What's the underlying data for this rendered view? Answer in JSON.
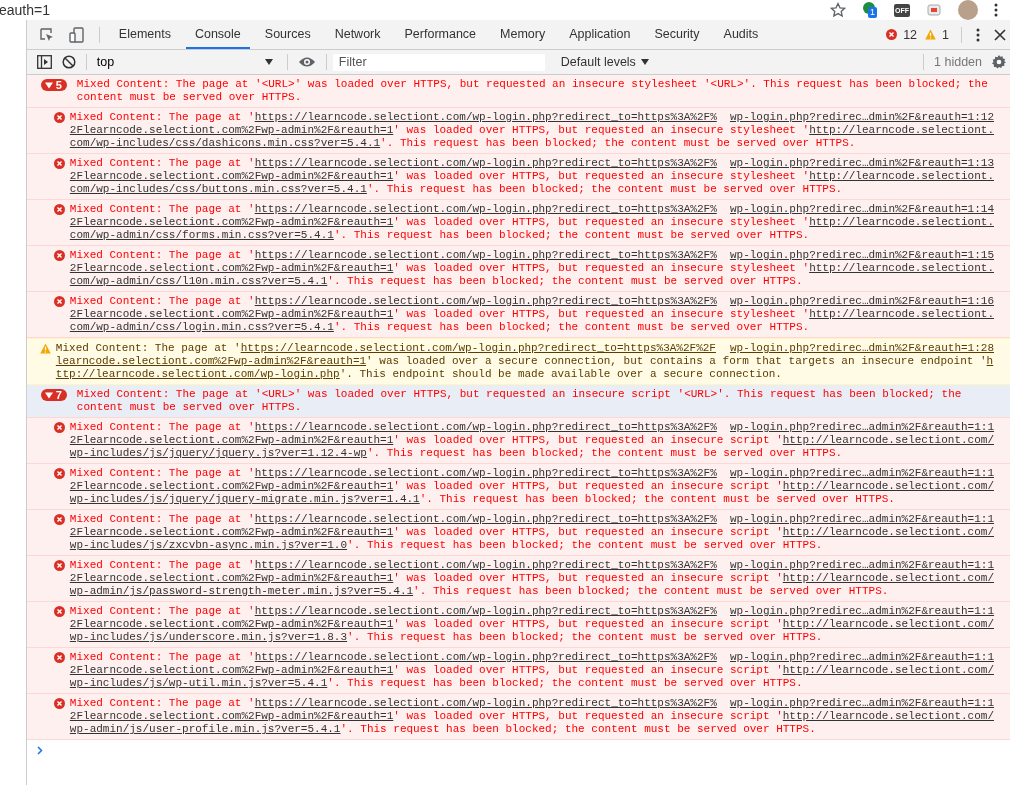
{
  "browser": {
    "address_fragment": "eauth=1",
    "extension_badge": "1",
    "extension_label": "OFF"
  },
  "devtools": {
    "tabs": [
      {
        "label": "Elements",
        "selected": false
      },
      {
        "label": "Console",
        "selected": true
      },
      {
        "label": "Sources",
        "selected": false
      },
      {
        "label": "Network",
        "selected": false
      },
      {
        "label": "Performance",
        "selected": false
      },
      {
        "label": "Memory",
        "selected": false
      },
      {
        "label": "Application",
        "selected": false
      },
      {
        "label": "Security",
        "selected": false
      },
      {
        "label": "Audits",
        "selected": false
      }
    ],
    "error_count": "12",
    "warning_count": "1"
  },
  "console_toolbar": {
    "context": "top",
    "filter_placeholder": "Filter",
    "levels": "Default levels",
    "hidden": "1 hidden"
  },
  "messages": [
    {
      "kind": "group",
      "count": "5",
      "expanded": true,
      "selected": false,
      "lines": [
        [
          {
            "text": "Mixed Content: The page at '<URL>' was loaded over HTTPS, but requested an insecure stylesheet '<URL>'. This request has been blocked; the",
            "link": false
          }
        ],
        [
          {
            "text": "content must be served over HTTPS.",
            "link": false
          }
        ]
      ]
    },
    {
      "kind": "error",
      "source": "wp-login.php?redirec…dmin%2F&reauth=1:12",
      "lines": [
        [
          {
            "text": "Mixed Content: The page at '",
            "link": false
          },
          {
            "text": "https://learncode.selectiont.com/wp-login.php?redirect_to=https%3A%2F%",
            "link": true
          }
        ],
        [
          {
            "text": "2Flearncode.selectiont.com%2Fwp-admin%2F&reauth=1",
            "link": true
          },
          {
            "text": "' was loaded over HTTPS, but requested an insecure stylesheet '",
            "link": false
          },
          {
            "text": "http://learncode.selectiont.",
            "link": true
          }
        ],
        [
          {
            "text": "com/wp-includes/css/dashicons.min.css?ver=5.4.1",
            "link": true
          },
          {
            "text": "'. This request has been blocked; the content must be served over HTTPS.",
            "link": false
          }
        ]
      ]
    },
    {
      "kind": "error",
      "source": "wp-login.php?redirec…dmin%2F&reauth=1:13",
      "lines": [
        [
          {
            "text": "Mixed Content: The page at '",
            "link": false
          },
          {
            "text": "https://learncode.selectiont.com/wp-login.php?redirect_to=https%3A%2F%",
            "link": true
          }
        ],
        [
          {
            "text": "2Flearncode.selectiont.com%2Fwp-admin%2F&reauth=1",
            "link": true
          },
          {
            "text": "' was loaded over HTTPS, but requested an insecure stylesheet '",
            "link": false
          },
          {
            "text": "http://learncode.selectiont.",
            "link": true
          }
        ],
        [
          {
            "text": "com/wp-includes/css/buttons.min.css?ver=5.4.1",
            "link": true
          },
          {
            "text": "'. This request has been blocked; the content must be served over HTTPS.",
            "link": false
          }
        ]
      ]
    },
    {
      "kind": "error",
      "source": "wp-login.php?redirec…dmin%2F&reauth=1:14",
      "lines": [
        [
          {
            "text": "Mixed Content: The page at '",
            "link": false
          },
          {
            "text": "https://learncode.selectiont.com/wp-login.php?redirect_to=https%3A%2F%",
            "link": true
          }
        ],
        [
          {
            "text": "2Flearncode.selectiont.com%2Fwp-admin%2F&reauth=1",
            "link": true
          },
          {
            "text": "' was loaded over HTTPS, but requested an insecure stylesheet '",
            "link": false
          },
          {
            "text": "http://learncode.selectiont.",
            "link": true
          }
        ],
        [
          {
            "text": "com/wp-admin/css/forms.min.css?ver=5.4.1",
            "link": true
          },
          {
            "text": "'. This request has been blocked; the content must be served over HTTPS.",
            "link": false
          }
        ]
      ]
    },
    {
      "kind": "error",
      "source": "wp-login.php?redirec…dmin%2F&reauth=1:15",
      "lines": [
        [
          {
            "text": "Mixed Content: The page at '",
            "link": false
          },
          {
            "text": "https://learncode.selectiont.com/wp-login.php?redirect_to=https%3A%2F%",
            "link": true
          }
        ],
        [
          {
            "text": "2Flearncode.selectiont.com%2Fwp-admin%2F&reauth=1",
            "link": true
          },
          {
            "text": "' was loaded over HTTPS, but requested an insecure stylesheet '",
            "link": false
          },
          {
            "text": "http://learncode.selectiont.",
            "link": true
          }
        ],
        [
          {
            "text": "com/wp-admin/css/l10n.min.css?ver=5.4.1",
            "link": true
          },
          {
            "text": "'. This request has been blocked; the content must be served over HTTPS.",
            "link": false
          }
        ]
      ]
    },
    {
      "kind": "error",
      "source": "wp-login.php?redirec…dmin%2F&reauth=1:16",
      "lines": [
        [
          {
            "text": "Mixed Content: The page at '",
            "link": false
          },
          {
            "text": "https://learncode.selectiont.com/wp-login.php?redirect_to=https%3A%2F%",
            "link": true
          }
        ],
        [
          {
            "text": "2Flearncode.selectiont.com%2Fwp-admin%2F&reauth=1",
            "link": true
          },
          {
            "text": "' was loaded over HTTPS, but requested an insecure stylesheet '",
            "link": false
          },
          {
            "text": "http://learncode.selectiont.",
            "link": true
          }
        ],
        [
          {
            "text": "com/wp-admin/css/login.min.css?ver=5.4.1",
            "link": true
          },
          {
            "text": "'. This request has been blocked; the content must be served over HTTPS.",
            "link": false
          }
        ]
      ]
    },
    {
      "kind": "warning",
      "source": "wp-login.php?redirec…dmin%2F&reauth=1:28",
      "lines": [
        [
          {
            "text": "Mixed Content: The page at '",
            "link": false
          },
          {
            "text": "https://learncode.selectiont.com/wp-login.php?redirect_to=https%3A%2F%2F",
            "link": true
          }
        ],
        [
          {
            "text": "learncode.selectiont.com%2Fwp-admin%2F&reauth=1",
            "link": true
          },
          {
            "text": "' was loaded over a secure connection, but contains a form that targets an insecure endpoint '",
            "link": false
          },
          {
            "text": "h",
            "link": true
          }
        ],
        [
          {
            "text": "ttp://learncode.selectiont.com/wp-login.php",
            "link": true
          },
          {
            "text": "'. This endpoint should be made available over a secure connection.",
            "link": false
          }
        ]
      ]
    },
    {
      "kind": "group",
      "count": "7",
      "expanded": true,
      "selected": true,
      "lines": [
        [
          {
            "text": "Mixed Content: The page at '<URL>' was loaded over HTTPS, but requested an insecure script '<URL>'. This request has been blocked; the",
            "link": false
          }
        ],
        [
          {
            "text": "content must be served over HTTPS.",
            "link": false
          }
        ]
      ]
    },
    {
      "kind": "error",
      "source": "wp-login.php?redirec…admin%2F&reauth=1:1",
      "lines": [
        [
          {
            "text": "Mixed Content: The page at '",
            "link": false
          },
          {
            "text": "https://learncode.selectiont.com/wp-login.php?redirect_to=https%3A%2F%",
            "link": true
          }
        ],
        [
          {
            "text": "2Flearncode.selectiont.com%2Fwp-admin%2F&reauth=1",
            "link": true
          },
          {
            "text": "' was loaded over HTTPS, but requested an insecure script '",
            "link": false
          },
          {
            "text": "http://learncode.selectiont.com/",
            "link": true
          }
        ],
        [
          {
            "text": "wp-includes/js/jquery/jquery.js?ver=1.12.4-wp",
            "link": true
          },
          {
            "text": "'. This request has been blocked; the content must be served over HTTPS.",
            "link": false
          }
        ]
      ]
    },
    {
      "kind": "error",
      "source": "wp-login.php?redirec…admin%2F&reauth=1:1",
      "lines": [
        [
          {
            "text": "Mixed Content: The page at '",
            "link": false
          },
          {
            "text": "https://learncode.selectiont.com/wp-login.php?redirect_to=https%3A%2F%",
            "link": true
          }
        ],
        [
          {
            "text": "2Flearncode.selectiont.com%2Fwp-admin%2F&reauth=1",
            "link": true
          },
          {
            "text": "' was loaded over HTTPS, but requested an insecure script '",
            "link": false
          },
          {
            "text": "http://learncode.selectiont.com/",
            "link": true
          }
        ],
        [
          {
            "text": "wp-includes/js/jquery/jquery-migrate.min.js?ver=1.4.1",
            "link": true
          },
          {
            "text": "'. This request has been blocked; the content must be served over HTTPS.",
            "link": false
          }
        ]
      ]
    },
    {
      "kind": "error",
      "source": "wp-login.php?redirec…admin%2F&reauth=1:1",
      "lines": [
        [
          {
            "text": "Mixed Content: The page at '",
            "link": false
          },
          {
            "text": "https://learncode.selectiont.com/wp-login.php?redirect_to=https%3A%2F%",
            "link": true
          }
        ],
        [
          {
            "text": "2Flearncode.selectiont.com%2Fwp-admin%2F&reauth=1",
            "link": true
          },
          {
            "text": "' was loaded over HTTPS, but requested an insecure script '",
            "link": false
          },
          {
            "text": "http://learncode.selectiont.com/",
            "link": true
          }
        ],
        [
          {
            "text": "wp-includes/js/zxcvbn-async.min.js?ver=1.0",
            "link": true
          },
          {
            "text": "'. This request has been blocked; the content must be served over HTTPS.",
            "link": false
          }
        ]
      ]
    },
    {
      "kind": "error",
      "source": "wp-login.php?redirec…admin%2F&reauth=1:1",
      "lines": [
        [
          {
            "text": "Mixed Content: The page at '",
            "link": false
          },
          {
            "text": "https://learncode.selectiont.com/wp-login.php?redirect_to=https%3A%2F%",
            "link": true
          }
        ],
        [
          {
            "text": "2Flearncode.selectiont.com%2Fwp-admin%2F&reauth=1",
            "link": true
          },
          {
            "text": "' was loaded over HTTPS, but requested an insecure script '",
            "link": false
          },
          {
            "text": "http://learncode.selectiont.com/",
            "link": true
          }
        ],
        [
          {
            "text": "wp-admin/js/password-strength-meter.min.js?ver=5.4.1",
            "link": true
          },
          {
            "text": "'. This request has been blocked; the content must be served over HTTPS.",
            "link": false
          }
        ]
      ]
    },
    {
      "kind": "error",
      "source": "wp-login.php?redirec…admin%2F&reauth=1:1",
      "lines": [
        [
          {
            "text": "Mixed Content: The page at '",
            "link": false
          },
          {
            "text": "https://learncode.selectiont.com/wp-login.php?redirect_to=https%3A%2F%",
            "link": true
          }
        ],
        [
          {
            "text": "2Flearncode.selectiont.com%2Fwp-admin%2F&reauth=1",
            "link": true
          },
          {
            "text": "' was loaded over HTTPS, but requested an insecure script '",
            "link": false
          },
          {
            "text": "http://learncode.selectiont.com/",
            "link": true
          }
        ],
        [
          {
            "text": "wp-includes/js/underscore.min.js?ver=1.8.3",
            "link": true
          },
          {
            "text": "'. This request has been blocked; the content must be served over HTTPS.",
            "link": false
          }
        ]
      ]
    },
    {
      "kind": "error",
      "source": "wp-login.php?redirec…admin%2F&reauth=1:1",
      "lines": [
        [
          {
            "text": "Mixed Content: The page at '",
            "link": false
          },
          {
            "text": "https://learncode.selectiont.com/wp-login.php?redirect_to=https%3A%2F%",
            "link": true
          }
        ],
        [
          {
            "text": "2Flearncode.selectiont.com%2Fwp-admin%2F&reauth=1",
            "link": true
          },
          {
            "text": "' was loaded over HTTPS, but requested an insecure script '",
            "link": false
          },
          {
            "text": "http://learncode.selectiont.com/",
            "link": true
          }
        ],
        [
          {
            "text": "wp-includes/js/wp-util.min.js?ver=5.4.1",
            "link": true
          },
          {
            "text": "'. This request has been blocked; the content must be served over HTTPS.",
            "link": false
          }
        ]
      ]
    },
    {
      "kind": "error",
      "source": "wp-login.php?redirec…admin%2F&reauth=1:1",
      "lines": [
        [
          {
            "text": "Mixed Content: The page at '",
            "link": false
          },
          {
            "text": "https://learncode.selectiont.com/wp-login.php?redirect_to=https%3A%2F%",
            "link": true
          }
        ],
        [
          {
            "text": "2Flearncode.selectiont.com%2Fwp-admin%2F&reauth=1",
            "link": true
          },
          {
            "text": "' was loaded over HTTPS, but requested an insecure script '",
            "link": false
          },
          {
            "text": "http://learncode.selectiont.com/",
            "link": true
          }
        ],
        [
          {
            "text": "wp-admin/js/user-profile.min.js?ver=5.4.1",
            "link": true
          },
          {
            "text": "'. This request has been blocked; the content must be served over HTTPS.",
            "link": false
          }
        ]
      ]
    }
  ]
}
